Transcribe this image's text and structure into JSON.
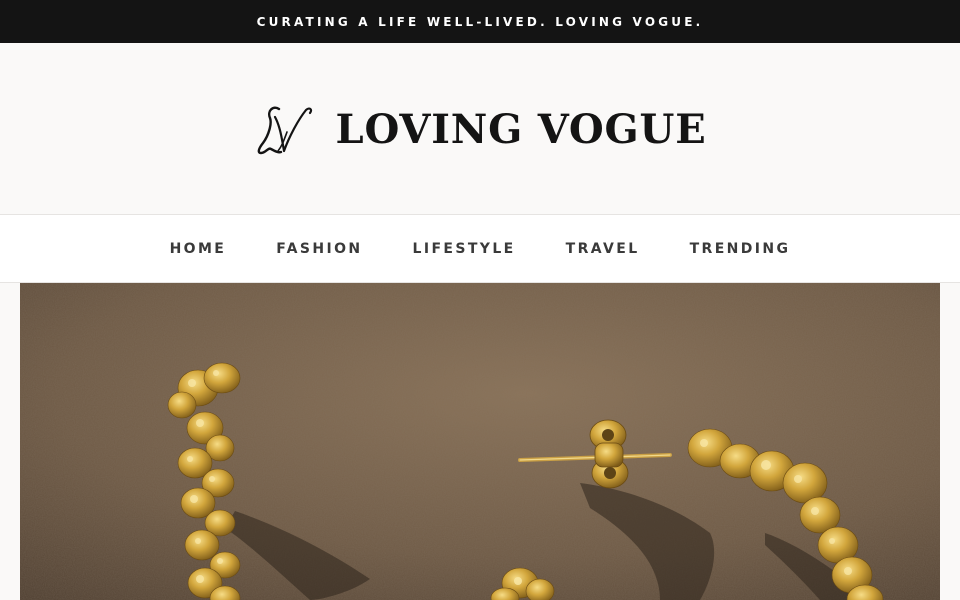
{
  "announcement": {
    "text": "CURATING A LIFE WELL-LIVED. LOVING VOGUE."
  },
  "header": {
    "logo_icon": "monogram-lv-icon",
    "title": "LOVING VOGUE"
  },
  "nav": {
    "items": [
      {
        "label": "HOME"
      },
      {
        "label": "FASHION"
      },
      {
        "label": "LIFESTYLE"
      },
      {
        "label": "TRAVEL"
      },
      {
        "label": "TRENDING"
      }
    ]
  },
  "hero": {
    "subject": "gold floral hoop earrings on brown suede"
  },
  "colors": {
    "topbar": "#141414",
    "page_bg": "#faf9f8",
    "nav_text": "#3a3a3a",
    "hero_bg": "#74604b",
    "gold": "#d2a63c"
  }
}
